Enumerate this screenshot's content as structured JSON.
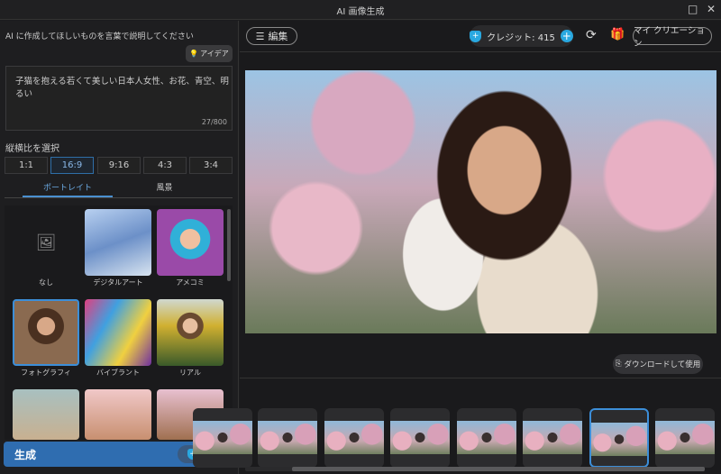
{
  "window": {
    "title": "AI 画像生成",
    "maximize_icon": "□",
    "close_icon": "✕"
  },
  "left": {
    "prompt_label": "AI に作成してほしいものを言葉で説明してください",
    "idea_button": "アイデア",
    "prompt_value": "子猫を抱える若くて美しい日本人女性、お花、青空、明るい",
    "char_count": "27/800",
    "aspect_label": "縦横比を選択",
    "aspects": [
      "1:1",
      "16:9",
      "9:16",
      "4:3",
      "3:4"
    ],
    "selected_aspect": "16:9",
    "tabs": [
      "ポートレイト",
      "風景"
    ],
    "active_tab": "ポートレイト",
    "styles": [
      "なし",
      "デジタルアート",
      "アメコミ",
      "フォトグラフィ",
      "バイブラント",
      "リアル",
      "",
      "",
      ""
    ],
    "selected_style": "フォトグラフィ",
    "generate_label": "生成",
    "generate_cost": "-2"
  },
  "toolbar": {
    "edit_label": "編集",
    "credits_label": "クレジット: 415",
    "my_creations_label": "マイ クリエーション"
  },
  "main": {
    "download_label": "ダウンロードして使用",
    "thumbnail_count_visible": 8,
    "selected_thumbnail": 6
  },
  "colors": {
    "accent": "#2f7dc4",
    "generate_bg": "#2f6db0",
    "credit_icon": "#29a8e0"
  }
}
